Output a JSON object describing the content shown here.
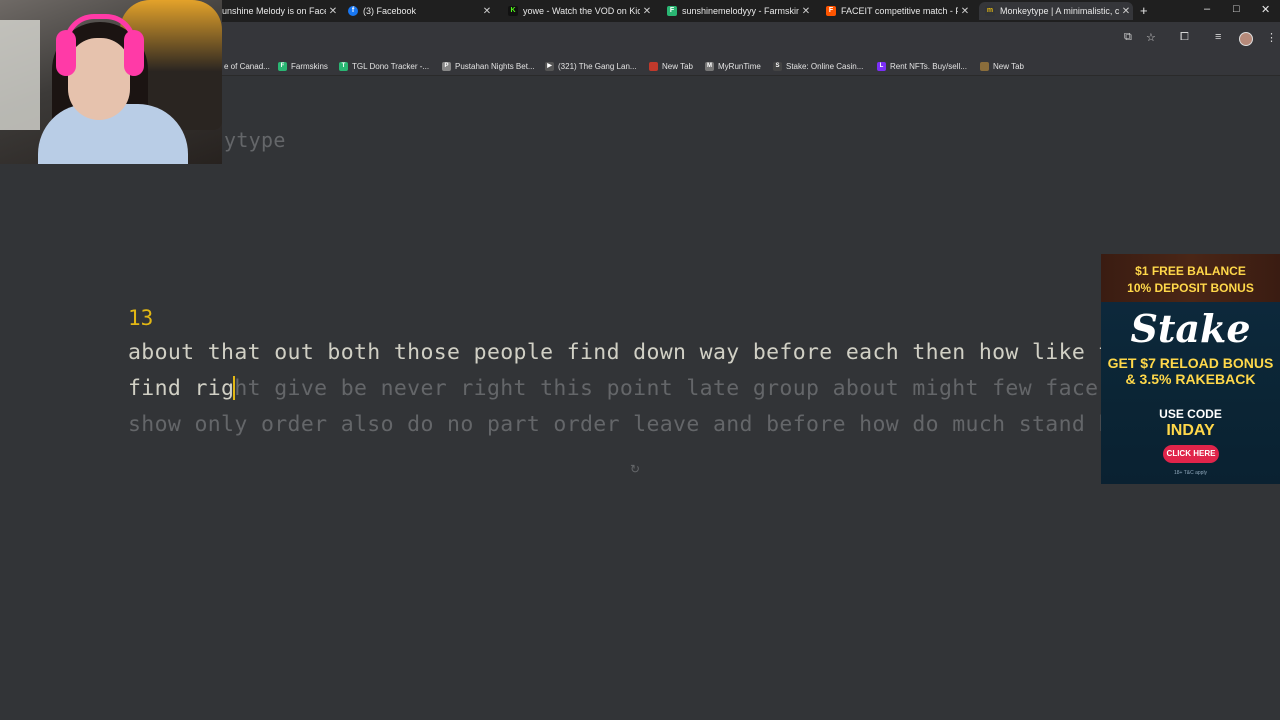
{
  "browser": {
    "tabs": [
      {
        "title": "unshine Melody is on Face",
        "favicon": "",
        "color": "#1f1f1f",
        "active": false
      },
      {
        "title": "(3) Facebook",
        "favicon": "f",
        "color": "#1877f2",
        "active": false
      },
      {
        "title": "yowe - Watch the VOD on Kick",
        "favicon": "K",
        "color": "#53fc18",
        "active": false
      },
      {
        "title": "sunshinemelodyyy - Farmskins",
        "favicon": "F",
        "color": "#2ab673",
        "active": false
      },
      {
        "title": "FACEIT competitive match - FA",
        "favicon": "F",
        "color": "#ff5500",
        "active": false
      },
      {
        "title": "Monkeytype | A minimalistic, c",
        "favicon": "m",
        "color": "#e2b714",
        "active": true
      }
    ],
    "new_tab_glyph": "+",
    "window_controls": [
      "–",
      "□",
      "✕"
    ],
    "bookmarks": [
      {
        "label": "e of Canad...",
        "favicon": "",
        "color": "#35363a"
      },
      {
        "label": "Farmskins",
        "favicon": "F",
        "color": "#2ab673"
      },
      {
        "label": "TGL Dono Tracker -...",
        "favicon": "T",
        "color": "#2ab673"
      },
      {
        "label": "Pustahan Nights Bet...",
        "favicon": "P",
        "color": "#888888"
      },
      {
        "label": "(321) The Gang Lan...",
        "favicon": "▶",
        "color": "#555555"
      },
      {
        "label": "New Tab",
        "favicon": "",
        "color": "#c0392b"
      },
      {
        "label": "MyRunTime",
        "favicon": "M",
        "color": "#777777"
      },
      {
        "label": "Stake: Online Casin...",
        "favicon": "S",
        "color": "#444444"
      },
      {
        "label": "Rent NFTs. Buy/sell...",
        "favicon": "L",
        "color": "#7b2ff7"
      },
      {
        "label": "New Tab",
        "favicon": "",
        "color": "#8a6d3b"
      }
    ]
  },
  "page": {
    "logo_partial": "ytype",
    "word_counter": "13",
    "line1": "about that out both those people find down way before each then how like tak",
    "line2_typed": "find rig",
    "line2_untyped": "ht give be never right this point late group about might few face wi",
    "line3": "show only order also do no part order leave and before how do much stand her",
    "restart_icon": "↻"
  },
  "ad": {
    "line1": "$1 FREE BALANCE",
    "line2": "10% DEPOSIT BONUS",
    "logo": "Stake",
    "line3": "GET $7 RELOAD BONUS & 3.5% RAKEBACK",
    "line4": "USE CODE",
    "code": "INDAY",
    "button": "CLICK HERE",
    "fine_print": "18+ T&C apply"
  },
  "colors": {
    "background": "#323437",
    "main_text": "#d1d0c5",
    "sub_text": "#646669",
    "accent": "#e2b714"
  }
}
